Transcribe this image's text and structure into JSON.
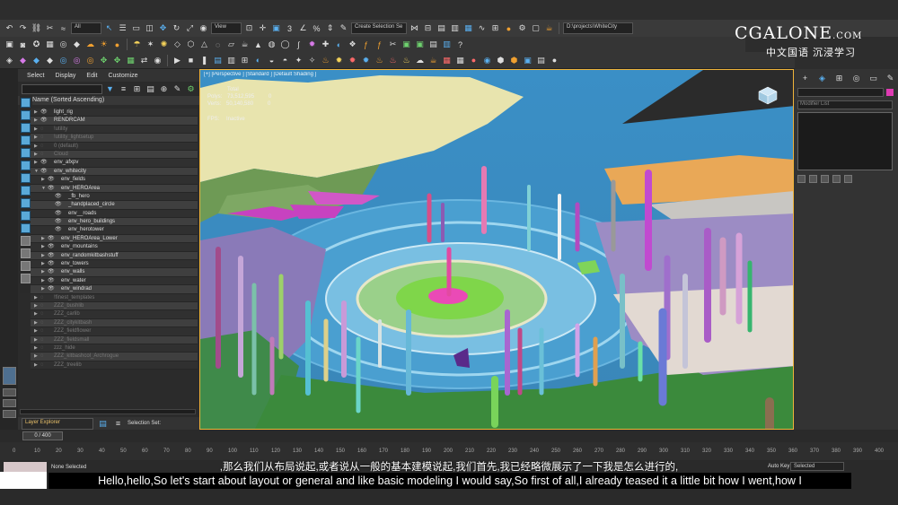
{
  "toolbar": {
    "filter_all": "All",
    "ref_coord": "View",
    "selection_set": "Create Selection Se",
    "project_path": "D:\\projects\\WhiteCity"
  },
  "watermark": {
    "logo_main": "CGALONE",
    "logo_suffix": ".COM",
    "tagline": "中文国语  沉浸学习"
  },
  "explorer": {
    "menus": [
      "Select",
      "Display",
      "Edit",
      "Customize"
    ],
    "column_header": "Name (Sorted Ascending)",
    "layers": [
      {
        "name": "light_rig",
        "indent": 0,
        "dim": false
      },
      {
        "name": "RENDRCAM",
        "indent": 0,
        "dim": false
      },
      {
        "name": "!utility",
        "indent": 0,
        "dim": true
      },
      {
        "name": "!utility_lightsetup",
        "indent": 0,
        "dim": true
      },
      {
        "name": "0 (default)",
        "indent": 0,
        "dim": true
      },
      {
        "name": "Cloud",
        "indent": 0,
        "dim": true
      },
      {
        "name": "env_afxpv",
        "indent": 0,
        "dim": false
      },
      {
        "name": "env_whitecity",
        "indent": 0,
        "dim": false
      },
      {
        "name": "env_fields",
        "indent": 1,
        "dim": false
      },
      {
        "name": "env_HEROArea",
        "indent": 1,
        "dim": false
      },
      {
        "name": "_fb_hero",
        "indent": 2,
        "dim": false
      },
      {
        "name": "_handplaced_circle",
        "indent": 2,
        "dim": false
      },
      {
        "name": "env__roads",
        "indent": 2,
        "dim": false
      },
      {
        "name": "env_hero_buildings",
        "indent": 2,
        "dim": false
      },
      {
        "name": "env_herotower",
        "indent": 2,
        "dim": false
      },
      {
        "name": "env_HEROArea_Lower",
        "indent": 1,
        "dim": false
      },
      {
        "name": "env_mountains",
        "indent": 1,
        "dim": false
      },
      {
        "name": "env_randomkitbashstuff",
        "indent": 1,
        "dim": false
      },
      {
        "name": "env_towers",
        "indent": 1,
        "dim": false
      },
      {
        "name": "env_walls",
        "indent": 1,
        "dim": false
      },
      {
        "name": "env_water",
        "indent": 1,
        "dim": false
      },
      {
        "name": "env_windrad",
        "indent": 1,
        "dim": false
      },
      {
        "name": "!finest_templates",
        "indent": 0,
        "dim": true
      },
      {
        "name": "ZZZ_bushlib",
        "indent": 0,
        "dim": true
      },
      {
        "name": "ZZZ_carlib",
        "indent": 0,
        "dim": true
      },
      {
        "name": "ZZZ_citykitbash",
        "indent": 0,
        "dim": true
      },
      {
        "name": "ZZZ_fieldflower",
        "indent": 0,
        "dim": true
      },
      {
        "name": "ZZZ_fieldsmall",
        "indent": 0,
        "dim": true
      },
      {
        "name": "zzz_hide",
        "indent": 0,
        "dim": true
      },
      {
        "name": "ZZZ_kitbashcol_Archrogue",
        "indent": 0,
        "dim": true
      },
      {
        "name": "ZZZ_treelib",
        "indent": 0,
        "dim": true
      }
    ],
    "footer_dropdown": "Layer Explorer",
    "footer_label": "Selection Set:"
  },
  "viewport": {
    "label": "[+] [Perspective ] [Standard ] [Default Shading ]",
    "stats_total": "Total",
    "polys_label": "Polys:",
    "polys_value": "73,512,595",
    "polys_sel": "0",
    "verts_label": "Verts:",
    "verts_value": "50,140,580",
    "verts_sel": "0",
    "fps_label": "FPS:",
    "fps_value": "Inactive"
  },
  "command_panel": {
    "modifier_list": "Modifier List"
  },
  "timeline": {
    "slider": "0 / 400",
    "ticks": [
      "0",
      "10",
      "20",
      "30",
      "40",
      "50",
      "60",
      "70",
      "80",
      "90",
      "100",
      "110",
      "120",
      "130",
      "140",
      "150",
      "160",
      "170",
      "180",
      "190",
      "200",
      "210",
      "220",
      "230",
      "240",
      "250",
      "260",
      "270",
      "280",
      "290",
      "300",
      "310",
      "320",
      "330",
      "340",
      "350",
      "360",
      "370",
      "380",
      "390",
      "400"
    ]
  },
  "status": {
    "selection": "None Selected",
    "auto_key": "Auto Key",
    "selected": "Selected"
  },
  "subtitles": {
    "chinese": ",那么我们从布局说起,或者说从一般的基本建模说起,我们首先,我已经略微展示了一下我是怎么进行的,",
    "english": "Hello,hello,So let's start about layout or general and like basic modeling I would say,So first of all,I already teased it a little bit how I went,how I"
  }
}
